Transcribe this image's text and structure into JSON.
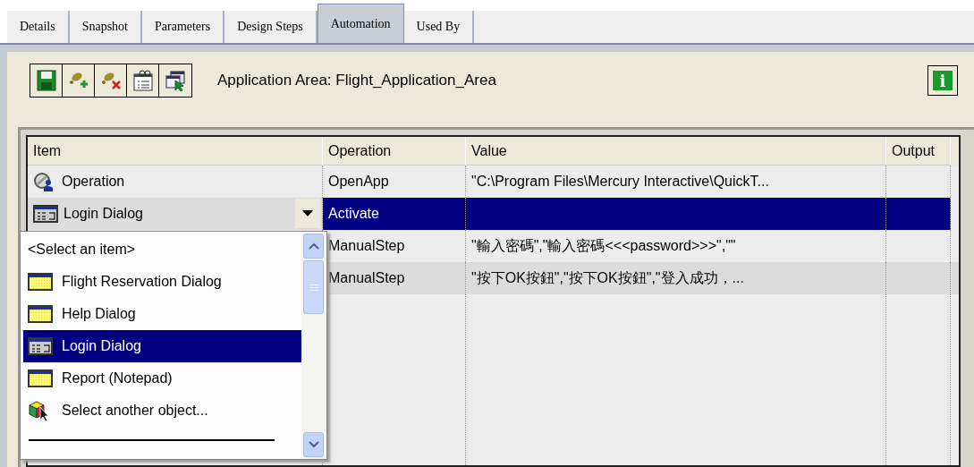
{
  "tabs": [
    {
      "label": "Details",
      "selected": false
    },
    {
      "label": "Snapshot",
      "selected": false
    },
    {
      "label": "Parameters",
      "selected": false
    },
    {
      "label": "Design Steps",
      "selected": false
    },
    {
      "label": "Automation",
      "selected": true
    },
    {
      "label": "Used By",
      "selected": false
    }
  ],
  "toolbar": {
    "buttons": [
      {
        "kind": "save"
      },
      {
        "kind": "add"
      },
      {
        "kind": "remove"
      },
      {
        "kind": "properties"
      },
      {
        "kind": "select"
      }
    ],
    "application_area": "Application Area: Flight_Application_Area",
    "info_button": {
      "label": "i"
    }
  },
  "table": {
    "columns": [
      "Item",
      "Operation",
      "Value",
      "Output"
    ],
    "rows": [
      {
        "kind": "plain",
        "item": {
          "text": "Operation",
          "kind": "operation"
        },
        "operation": "OpenApp",
        "value": "\"C:\\Program Files\\Mercury Interactive\\QuickT...",
        "selected": false
      },
      {
        "kind": "combo",
        "item": {
          "text": "Login Dialog",
          "kind": "dialog"
        },
        "operation": "Activate",
        "selected": true
      },
      {
        "kind": "plain",
        "operation": "ManualStep",
        "value": "\"輸入密碼\",\"輸入密碼<<<password>>>\",\"\"",
        "selected": false
      },
      {
        "kind": "plain",
        "operation": "ManualStep",
        "value": "\"按下OK按鈕\",\"按下OK按鈕\",\"登入成功，...",
        "selected": false
      }
    ]
  },
  "dropdown": {
    "items": [
      {
        "label": "<Select an item>",
        "kind": "prompt",
        "selected": false
      },
      {
        "label": "Flight Reservation Dialog",
        "kind": "window",
        "selected": false
      },
      {
        "label": "Help Dialog",
        "kind": "window",
        "selected": false
      },
      {
        "label": "Login Dialog",
        "kind": "dialog",
        "selected": true
      },
      {
        "label": "Report (Notepad)",
        "kind": "window",
        "selected": false
      },
      {
        "label": "Select another object...",
        "kind": "object",
        "selected": false
      }
    ]
  }
}
